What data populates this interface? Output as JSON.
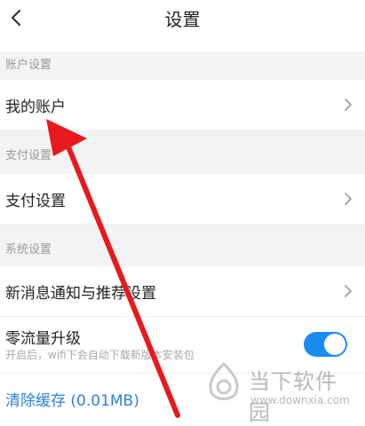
{
  "header": {
    "title": "设置",
    "back_icon": "chevron-left-icon"
  },
  "sections": {
    "account": "账户设置",
    "payment": "支付设置",
    "system": "系统设置"
  },
  "rows": {
    "my_account": "我的账户",
    "payment_settings": "支付设置",
    "notifications": "新消息通知与推荐设置",
    "zero_traffic": "零流量升级",
    "zero_traffic_desc": "开启后，wifi下会自动下载新版本安装包",
    "clear_cache": "清除缓存 (0.01MB)"
  },
  "toggle": {
    "on": true,
    "color": "#1a8cf0"
  },
  "colors": {
    "annotation_arrow": "#e8191d",
    "section_bg": "#f2f3f5",
    "link": "#2f7fd6"
  },
  "watermark": {
    "name": "当下软件园",
    "url": "www.downxia.com"
  }
}
